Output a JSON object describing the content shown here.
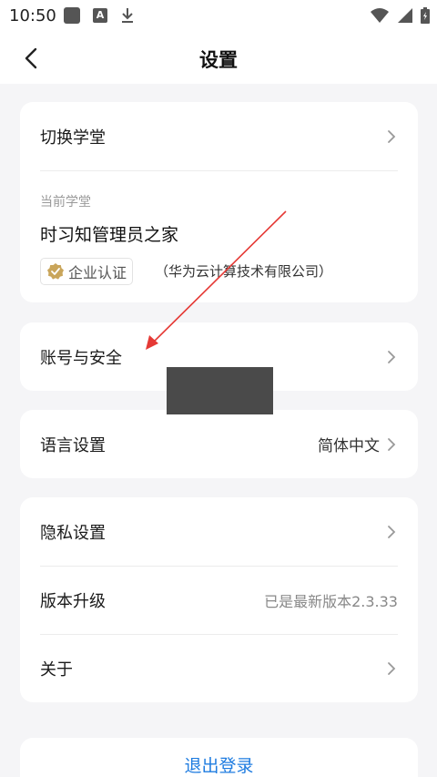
{
  "status_bar": {
    "time": "10:50",
    "a_label": "A"
  },
  "nav": {
    "title": "设置"
  },
  "school_card": {
    "switch_label": "切换学堂",
    "current_label": "当前学堂",
    "school_name": "时习知管理员之家",
    "badge": "企业认证",
    "company": "（华为云计算技术有限公司）"
  },
  "account": {
    "label": "账号与安全"
  },
  "language": {
    "label": "语言设置",
    "value": "简体中文"
  },
  "misc": {
    "privacy_label": "隐私设置",
    "version_label": "版本升级",
    "version_value": "已是最新版本2.3.33",
    "about_label": "关于"
  },
  "logout": {
    "label": "退出登录"
  },
  "colors": {
    "accent": "#1f7ce0",
    "arrow": "#e53935",
    "badge": "#c9a55a"
  }
}
